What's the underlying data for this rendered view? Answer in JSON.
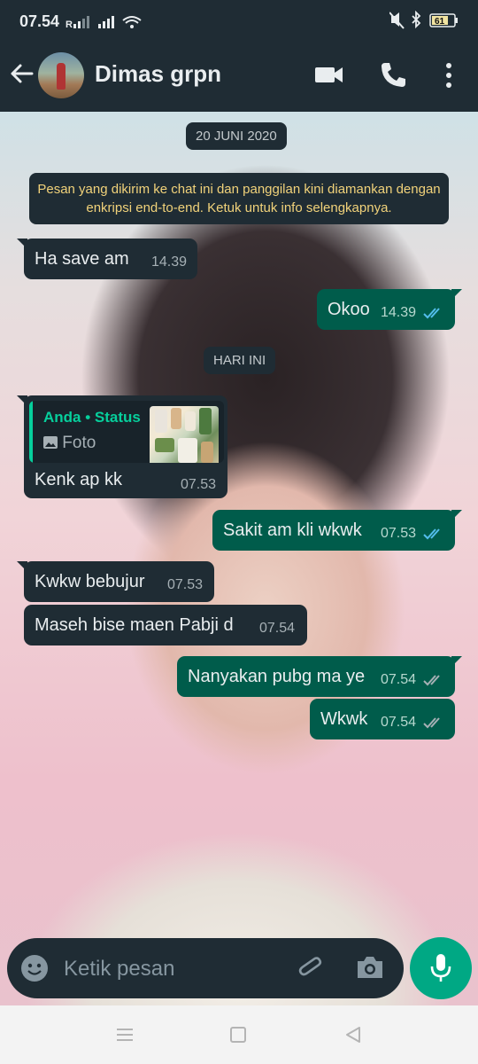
{
  "status_bar": {
    "time": "07.54",
    "battery": "61"
  },
  "header": {
    "contact_name": "Dimas grpn",
    "icons": [
      "back-arrow-icon",
      "avatar",
      "video-call-icon",
      "voice-call-icon",
      "more-vert-icon"
    ]
  },
  "chat": {
    "date_chip_1": "20 JUNI 2020",
    "encryption_notice": "Pesan yang dikirim ke chat ini dan panggilan kini diamankan dengan enkripsi end-to-end. Ketuk untuk info selengkapnya.",
    "date_chip_2": "HARI INI",
    "messages": [
      {
        "direction": "in",
        "text": "Ha save am",
        "time": "14.39"
      },
      {
        "direction": "out",
        "text": "Okoo",
        "time": "14.39",
        "status": "read"
      },
      {
        "direction": "in",
        "text": "Kenk ap kk",
        "time": "07.53",
        "quote": {
          "author": "Anda",
          "source": "Status",
          "type_label": "Foto"
        }
      },
      {
        "direction": "out",
        "text": "Sakit am kli wkwk",
        "time": "07.53",
        "status": "read"
      },
      {
        "direction": "in",
        "text": "Kwkw bebujur",
        "time": "07.53"
      },
      {
        "direction": "in",
        "text": "Maseh bise maen Pabji d",
        "time": "07.54"
      },
      {
        "direction": "out",
        "text": "Nanyakan pubg ma ye",
        "time": "07.54",
        "status": "delivered"
      },
      {
        "direction": "out",
        "text": "Wkwk",
        "time": "07.54",
        "status": "delivered"
      }
    ]
  },
  "composer": {
    "placeholder": "Ketik pesan",
    "icons": [
      "emoji-icon",
      "attach-icon",
      "camera-icon",
      "mic-icon"
    ]
  },
  "colors": {
    "bar_bg": "#1f2c34",
    "incoming_bubble": "#1f2c34",
    "outgoing_bubble": "#005c4b",
    "accent": "#00a884",
    "read_ticks": "#53bdeb",
    "notice_text": "#f1d27a"
  }
}
